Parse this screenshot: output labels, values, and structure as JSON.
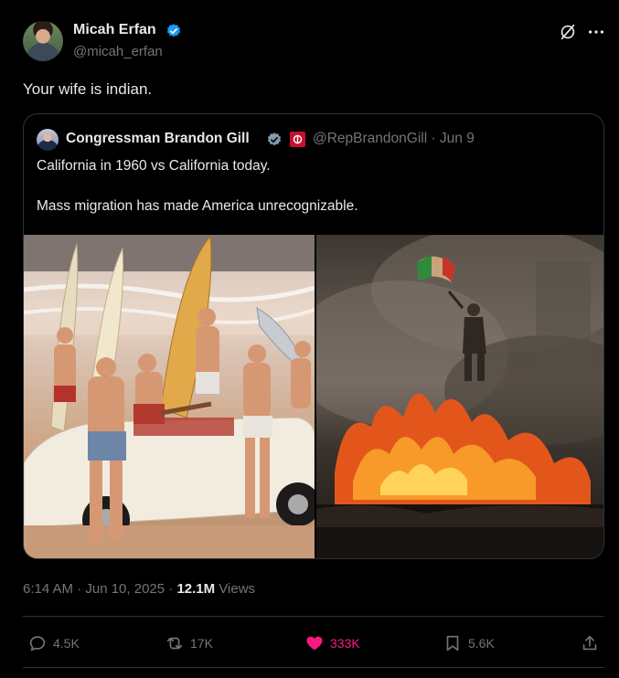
{
  "author": {
    "name": "Micah Erfan",
    "handle": "@micah_erfan",
    "verified_color": "#1d9bf0",
    "avatar_icon": "user-photo"
  },
  "tweet_text": "Your wife is indian.",
  "quote": {
    "name": "Congressman Brandon Gill",
    "handle_date": "@RepBrandonGill · Jun 9",
    "verified_color": "#829aab",
    "badge_icon": "affiliate-flag-badge",
    "line1": "California in 1960 vs California today.",
    "line2": "Mass migration has made America unrecognizable.",
    "images": [
      "beach-surfers-1960-photo",
      "burning-car-protest-photo"
    ]
  },
  "meta": {
    "time": "6:14 AM · Jun 10, 2025 · ",
    "views_count": "12.1M",
    "views_label": " Views"
  },
  "actions": {
    "replies": "4.5K",
    "reposts": "17K",
    "likes": "333K",
    "bookmarks": "5.6K",
    "like_color": "#f91880"
  }
}
